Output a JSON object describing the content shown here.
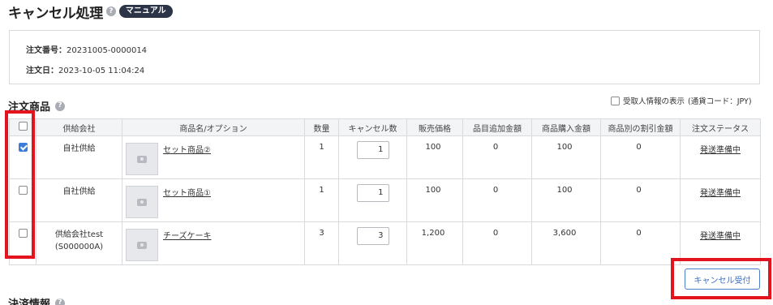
{
  "header": {
    "title": "キャンセル処理",
    "help_icon": "?",
    "manual_badge": "マニュアル"
  },
  "order_info": {
    "number_label": "注文番号：",
    "number_value": "20231005-0000014",
    "date_label": "注文日：",
    "date_value": "2023-10-05 11:04:24"
  },
  "items_section": {
    "title": "注文商品",
    "recipient_toggle_label": "受取人情報の表示",
    "currency_note": "(通貨コード：JPY)",
    "columns": [
      "供給会社",
      "商品名/オプション",
      "数量",
      "キャンセル数",
      "販売価格",
      "品目追加金額",
      "商品購入金額",
      "商品別の割引金額",
      "注文ステータス"
    ],
    "rows": [
      {
        "checked": true,
        "supplier": "自社供給",
        "supplier_code": "",
        "product": "セット商品②",
        "qty": "1",
        "cancel_qty": "1",
        "price": "100",
        "option_amount": "0",
        "purchase_amount": "100",
        "discount": "0",
        "status": "発送準備中"
      },
      {
        "checked": false,
        "supplier": "自社供給",
        "supplier_code": "",
        "product": "セット商品①",
        "qty": "1",
        "cancel_qty": "1",
        "price": "100",
        "option_amount": "0",
        "purchase_amount": "100",
        "discount": "0",
        "status": "発送準備中"
      },
      {
        "checked": false,
        "supplier": "供給会社test",
        "supplier_code": "(S000000A)",
        "product": "チーズケーキ",
        "qty": "3",
        "cancel_qty": "3",
        "price": "1,200",
        "option_amount": "0",
        "purchase_amount": "3,600",
        "discount": "0",
        "status": "発送準備中"
      }
    ]
  },
  "actions": {
    "cancel_accept_label": "キャンセル受付"
  },
  "payment_section": {
    "title": "決済情報"
  },
  "colors": {
    "highlight": "#e3141d",
    "accent": "#3b7ddd",
    "badge_bg": "#2c3447"
  }
}
